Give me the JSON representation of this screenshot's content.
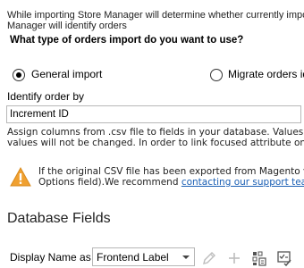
{
  "intro": {
    "line1": "While importing Store Manager will determine whether currently impor",
    "line2": "Manager will identify orders"
  },
  "question": "What type of orders import do you want to use?",
  "import_types": {
    "general": {
      "label": "General import",
      "selected": true
    },
    "migrate": {
      "label": "Migrate orders id",
      "selected": false
    }
  },
  "identify": {
    "label": "Identify order by",
    "value": "Increment ID"
  },
  "assign_text": {
    "line1": "Assign columns from .csv file to fields in your database. Values fo",
    "line2": "values will not be changed. In order to link focused attribute on"
  },
  "warning": {
    "icon": "warning-icon",
    "line1": "If the original CSV file has been exported from Magento ve",
    "line2_prefix": "Options field).We recommend ",
    "link_text": "contacting our support tear"
  },
  "database_fields": {
    "title": "Database Fields",
    "display_name_label": "Display Name as",
    "display_name_value": "Frontend Label"
  },
  "toolbar_icons": [
    "edit-icon",
    "add-icon",
    "grid-settings-icon",
    "checklist-icon"
  ],
  "colors": {
    "link": "#1a5fb4",
    "warning": "#f0a030"
  }
}
